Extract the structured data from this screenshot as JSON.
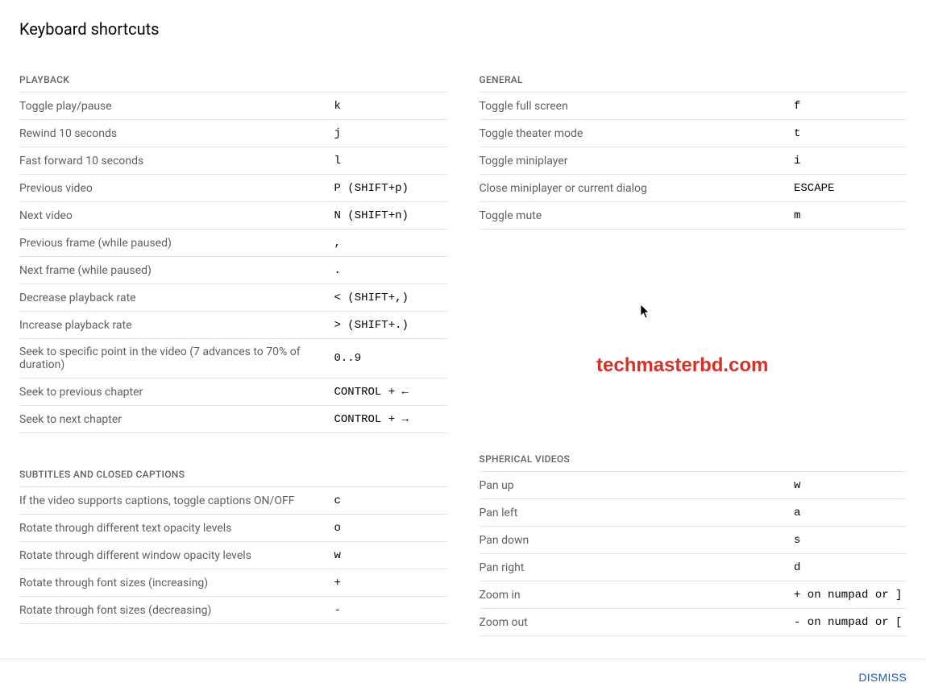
{
  "title": "Keyboard shortcuts",
  "dismiss_label": "DISMISS",
  "watermark": "techmasterbd.com",
  "left_sections": [
    {
      "header": "PLAYBACK",
      "rows": [
        {
          "desc": "Toggle play/pause",
          "key": "k"
        },
        {
          "desc": "Rewind 10 seconds",
          "key": "j"
        },
        {
          "desc": "Fast forward 10 seconds",
          "key": "l"
        },
        {
          "desc": "Previous video",
          "key": "P (SHIFT+p)"
        },
        {
          "desc": "Next video",
          "key": "N (SHIFT+n)"
        },
        {
          "desc": "Previous frame (while paused)",
          "key": ","
        },
        {
          "desc": "Next frame (while paused)",
          "key": "."
        },
        {
          "desc": "Decrease playback rate",
          "key": "< (SHIFT+,)"
        },
        {
          "desc": "Increase playback rate",
          "key": "> (SHIFT+.)"
        },
        {
          "desc": "Seek to specific point in the video (7 advances to 70% of duration)",
          "key": "0..9"
        },
        {
          "desc": "Seek to previous chapter",
          "key": "CONTROL + ←"
        },
        {
          "desc": "Seek to next chapter",
          "key": "CONTROL + →"
        }
      ]
    },
    {
      "header": "SUBTITLES AND CLOSED CAPTIONS",
      "rows": [
        {
          "desc": "If the video supports captions, toggle captions ON/OFF",
          "key": "c"
        },
        {
          "desc": "Rotate through different text opacity levels",
          "key": "o"
        },
        {
          "desc": "Rotate through different window opacity levels",
          "key": "w"
        },
        {
          "desc": "Rotate through font sizes (increasing)",
          "key": "+"
        },
        {
          "desc": "Rotate through font sizes (decreasing)",
          "key": "-"
        }
      ]
    }
  ],
  "right_sections": [
    {
      "header": "GENERAL",
      "rows": [
        {
          "desc": "Toggle full screen",
          "key": "f"
        },
        {
          "desc": "Toggle theater mode",
          "key": "t"
        },
        {
          "desc": "Toggle miniplayer",
          "key": "i"
        },
        {
          "desc": "Close miniplayer or current dialog",
          "key": "ESCAPE"
        },
        {
          "desc": "Toggle mute",
          "key": "m"
        }
      ]
    },
    {
      "header": "SPHERICAL VIDEOS",
      "rows": [
        {
          "desc": "Pan up",
          "key": "w"
        },
        {
          "desc": "Pan left",
          "key": "a"
        },
        {
          "desc": "Pan down",
          "key": "s"
        },
        {
          "desc": "Pan right",
          "key": "d"
        },
        {
          "desc": "Zoom in",
          "key": "+ on numpad or ]"
        },
        {
          "desc": "Zoom out",
          "key": "- on numpad or ["
        }
      ]
    }
  ]
}
